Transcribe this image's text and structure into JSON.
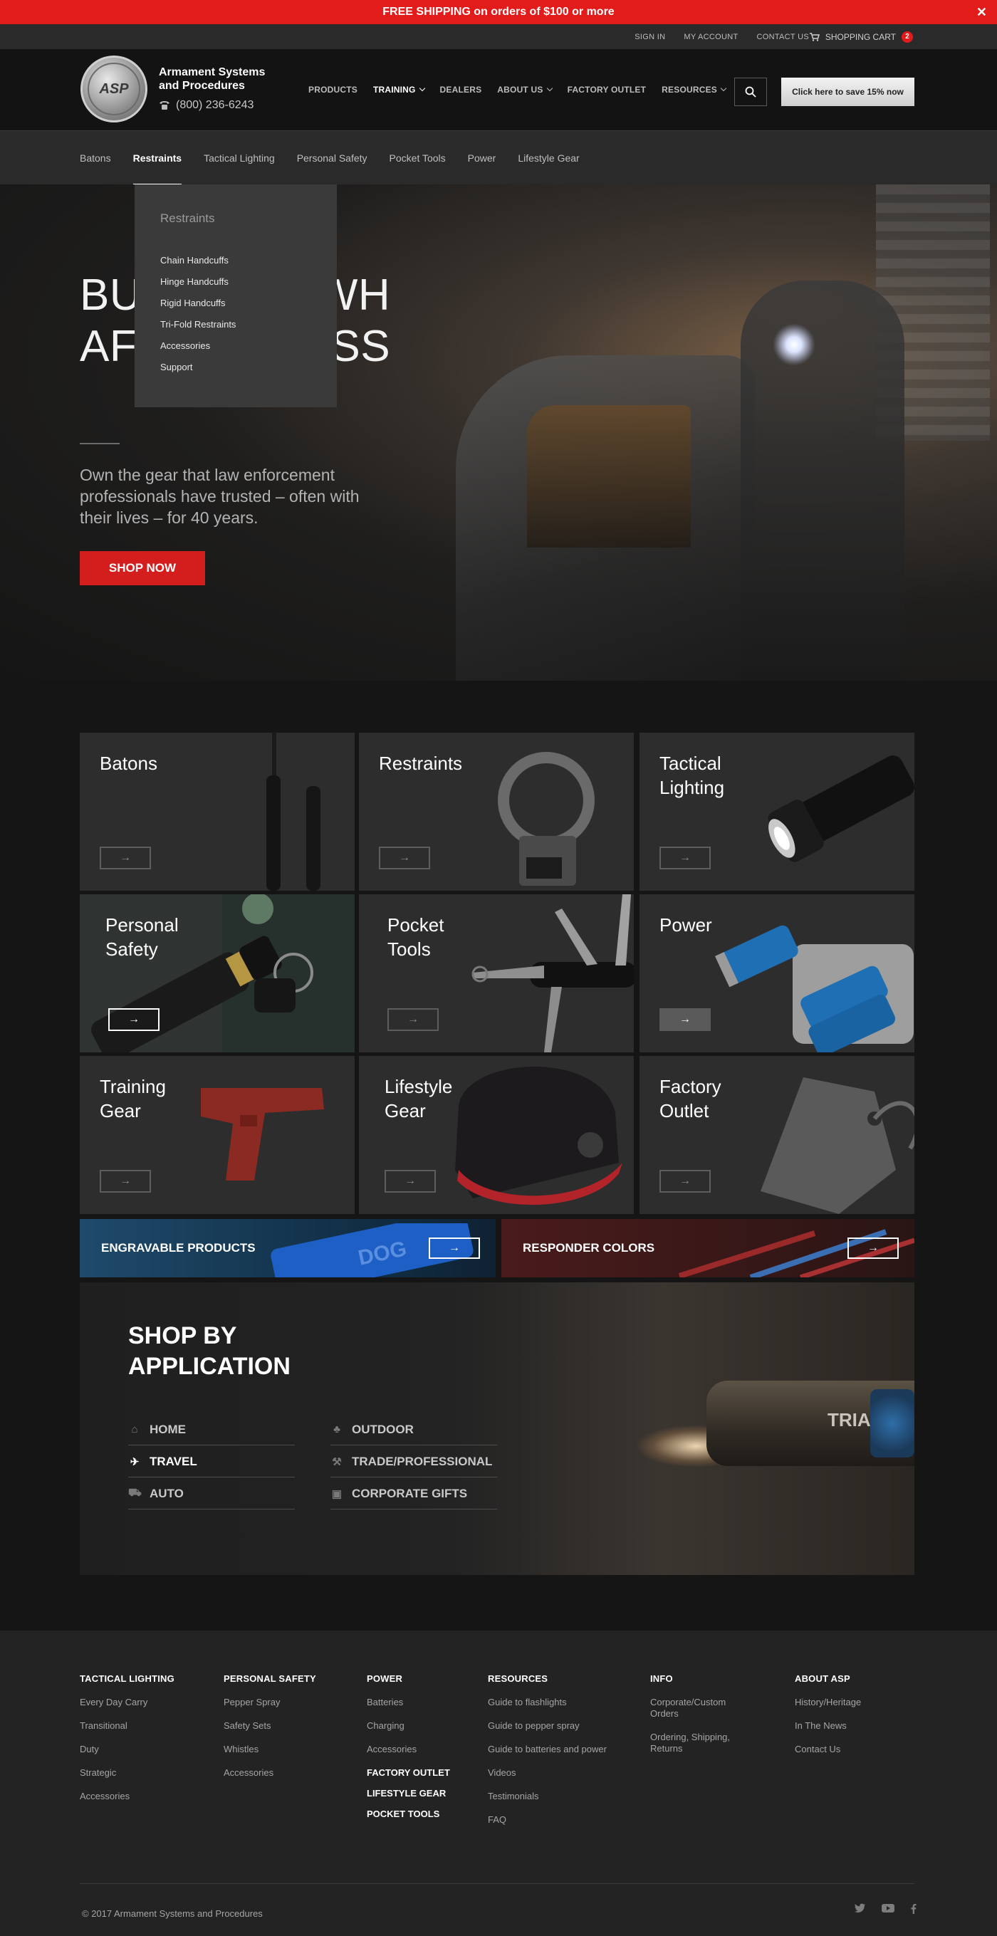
{
  "banner": {
    "text": "FREE SHIPPING on orders of $100 or more",
    "close": "✕"
  },
  "utility": {
    "sign_in": "SIGN IN",
    "my_account": "MY ACCOUNT",
    "contact_us": "CONTACT US",
    "cart_label": "SHOPPING CART",
    "cart_count": "2"
  },
  "header": {
    "brand_name": "Armament Systems and Procedures",
    "logo_text": "ASP",
    "phone": "(800) 236-6243",
    "nav": [
      "PRODUCTS",
      "TRAINING",
      "DEALERS",
      "ABOUT US",
      "FACTORY OUTLET",
      "RESOURCES"
    ],
    "save_cta": "Click here to save 15% now"
  },
  "subnav": [
    "Batons",
    "Restraints",
    "Tactical Lighting",
    "Personal Safety",
    "Pocket Tools",
    "Power",
    "Lifestyle Gear"
  ],
  "dropdown": {
    "title": "Restraints",
    "items": [
      "Chain Handcuffs",
      "Hinge Handcuffs",
      "Rigid Handcuffs",
      "Tri-Fold Restraints",
      "Accessories",
      "Support"
    ]
  },
  "hero": {
    "headline_visible": "BU               EOPLE WH           AFFORD LESS",
    "lead": "Own the gear that law enforcement professionals have trusted – often with their lives – for 40 years.",
    "cta": "SHOP NOW"
  },
  "categories": {
    "batons": "Batons",
    "restraints": "Restraints",
    "tactical_lighting": "Tactical Lighting",
    "personal_safety": "Personal Safety",
    "pocket_tools": "Pocket Tools",
    "power": "Power",
    "training_gear": "Training Gear",
    "lifestyle_gear": "Lifestyle Gear",
    "factory_outlet": "Factory Outlet",
    "arrow": "→"
  },
  "promos": {
    "engravable": "ENGRAVABLE PRODUCTS",
    "responder": "RESPONDER COLORS",
    "engravable_mark": "DOG"
  },
  "sba": {
    "title": "SHOP BY APPLICATION",
    "options": [
      "HOME",
      "OUTDOOR",
      "TRAVEL",
      "TRADE/PROFESSIONAL",
      "AUTO",
      "CORPORATE GIFTS"
    ],
    "torch_mark": "TRIAD"
  },
  "footer": {
    "tactical_lighting": {
      "title": "TACTICAL LIGHTING",
      "links": [
        "Every Day Carry",
        "Transitional",
        "Duty",
        "Strategic",
        "Accessories"
      ]
    },
    "personal_safety": {
      "title": "PERSONAL SAFETY",
      "links": [
        "Pepper Spray",
        "Safety Sets",
        "Whistles",
        "Accessories"
      ]
    },
    "power": {
      "title": "POWER",
      "links": [
        "Batteries",
        "Charging",
        "Accessories"
      ],
      "extras": [
        "FACTORY OUTLET",
        "LIFESTYLE GEAR",
        "POCKET TOOLS"
      ]
    },
    "resources": {
      "title": "RESOURCES",
      "links": [
        "Guide to flashlights",
        "Guide to pepper spray",
        "Guide to batteries and power",
        "Videos",
        "Testimonials",
        "FAQ"
      ]
    },
    "info": {
      "title": "INFO",
      "links": [
        "Corporate/Custom Orders",
        "Ordering, Shipping, Returns"
      ]
    },
    "about": {
      "title": "ABOUT ASP",
      "links": [
        "History/Heritage",
        "In The News",
        "Contact Us"
      ]
    },
    "copyright": "© 2017 Armament Systems and Procedures"
  },
  "colors": {
    "accent": "#e21b1b",
    "bg": "#151515",
    "panel": "#2d2d2d"
  }
}
